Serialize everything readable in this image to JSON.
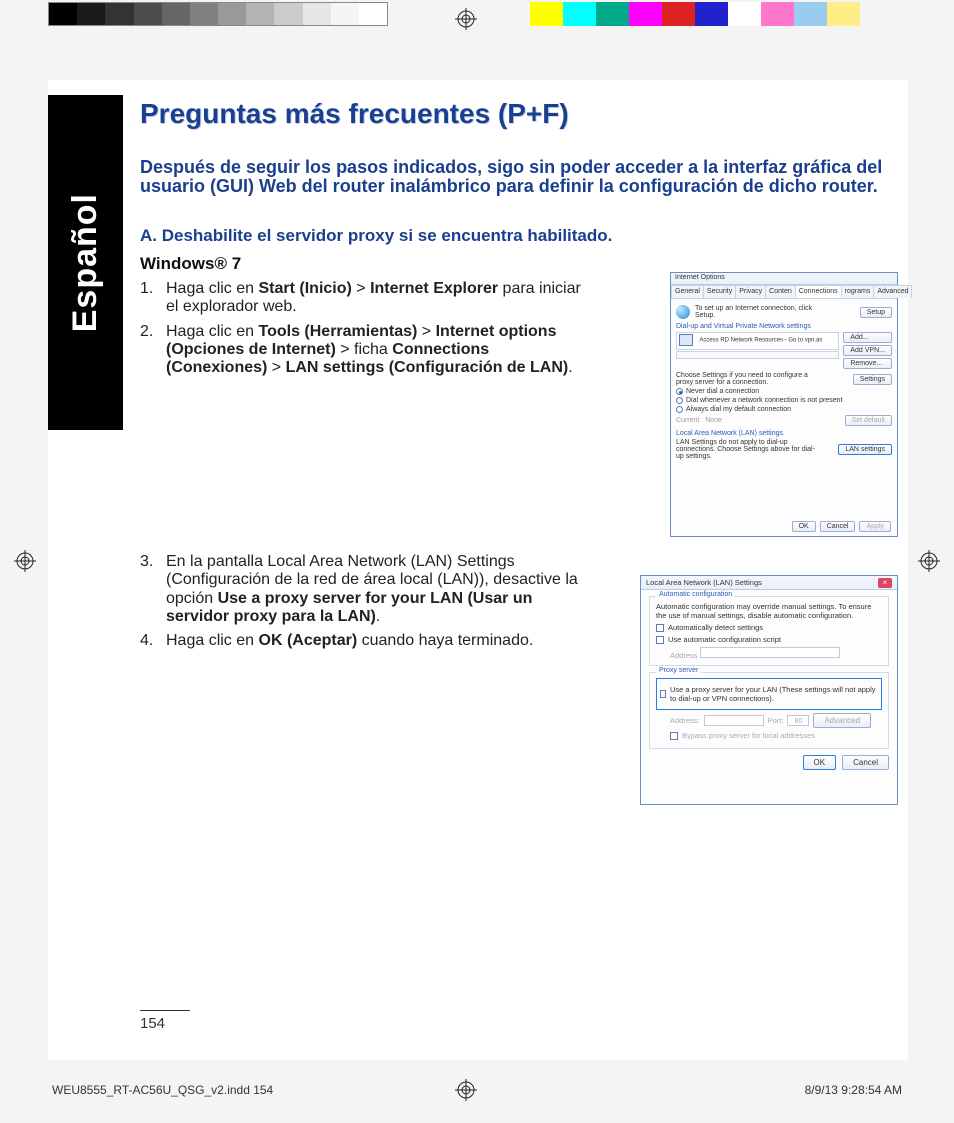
{
  "language_tab": "Español",
  "title": "Preguntas más frecuentes (P+F)",
  "subtitle": "Después de seguir los pasos indicados, sigo sin poder acceder a la interfaz gráfica del usuario (GUI) Web del router inalámbrico para definir la configuración de dicho router.",
  "sectionA": "A.   Deshabilite el servidor proxy si se encuentra habilitado.",
  "windows_label": "Windows® 7",
  "steps": {
    "s1": {
      "num": "1.",
      "pre": "Haga clic en ",
      "b1": "Start (Inicio)",
      "gt1": " > ",
      "b2": "Internet Explorer",
      "post": " para iniciar el explorador web."
    },
    "s2": {
      "num": "2.",
      "pre": "Haga clic en ",
      "b1": "Tools (Herramientas)",
      "gt1": " > ",
      "b2": "Internet options (Opciones de Internet)",
      "gt2": " > ficha ",
      "b3": "Connections (Conexiones)",
      "gt3": " > ",
      "b4": "LAN settings (Configuración de LAN)",
      "post": "."
    },
    "s3": {
      "num": "3.",
      "pre": "En la pantalla Local Area Network (LAN) Settings (Configuración de la red de área local (LAN)), desactive la opción ",
      "b1": "Use a proxy server for your LAN (Usar un servidor proxy para la LAN)",
      "post": "."
    },
    "s4": {
      "num": "4.",
      "pre": "Haga clic en ",
      "b1": "OK (Aceptar)",
      "post": " cuando haya terminado."
    }
  },
  "shot1": {
    "title": "Internet Options",
    "tabs": [
      "General",
      "Security",
      "Privacy",
      "Conten",
      "Connections",
      "rograms",
      "Advanced"
    ],
    "setup_text": "To set up an Internet connection, click Setup.",
    "setup_btn": "Setup",
    "dial_header": "Dial-up and Virtual Private Network settings",
    "dial_entry": "Access RD Network Resources - Go to vpn.as",
    "add_btn": "Add...",
    "addvpn_btn": "Add VPN...",
    "remove_btn": "Remove...",
    "choose_text": "Choose Settings if you need to configure a proxy server for a connection.",
    "settings_btn": "Settings",
    "r1": "Never dial a connection",
    "r2": "Dial whenever a network connection is not present",
    "r3": "Always dial my default connection",
    "current": "Current",
    "none": "None",
    "setdef": "Set default",
    "lan_header": "Local Area Network (LAN) settings",
    "lan_text": "LAN Settings do not apply to dial-up connections. Choose Settings above for dial-up settings.",
    "lan_btn": "LAN settings",
    "ok": "OK",
    "cancel": "Cancel",
    "apply": "Apply"
  },
  "shot2": {
    "title": "Local Area Network (LAN) Settings",
    "grp1": "Automatic configuration",
    "grp1_text": "Automatic configuration may override manual settings. To ensure the use of manual settings, disable automatic configuration.",
    "chk1": "Automatically detect settings",
    "chk2": "Use automatic configuration script",
    "addr": "Address",
    "grp2": "Proxy server",
    "proxy_chk": "Use a proxy server for your LAN (These settings will not apply to dial-up or VPN connections).",
    "addr2": "Address:",
    "port": "Port:",
    "port_val": "80",
    "adv": "Advanced",
    "bypass": "Bypass proxy server for local addresses",
    "ok": "OK",
    "cancel": "Cancel"
  },
  "page_number": "154",
  "footer_left": "WEU8555_RT-AC56U_QSG_v2.indd   154",
  "footer_right": "8/9/13   9:28:54 AM"
}
